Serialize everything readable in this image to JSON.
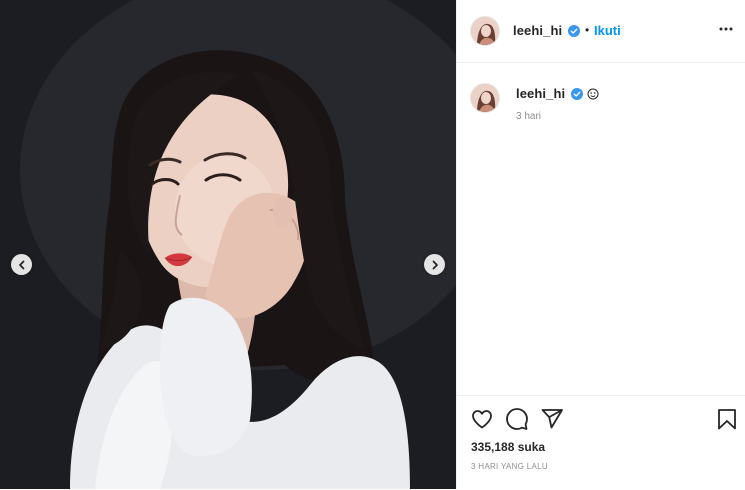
{
  "post": {
    "username": "leehi_hi",
    "follow_label": "Ikuti",
    "separator": "•",
    "caption_time": "3 hari",
    "likes_text": "335,188 suka",
    "date_text": "3 HARI YANG LALU"
  },
  "icons": {
    "verified": "verified-badge-icon",
    "more": "more-options-icon",
    "like": "heart-icon",
    "comment": "comment-icon",
    "share": "send-icon",
    "save": "bookmark-icon",
    "prev": "chevron-left-icon",
    "next": "chevron-right-icon",
    "caption_emoji": "emoji-face-icon"
  },
  "colors": {
    "accent": "#0095f6",
    "text": "#262626",
    "muted": "#8e8e8e",
    "border": "#efefef",
    "photo_background": "#1d1f24"
  }
}
